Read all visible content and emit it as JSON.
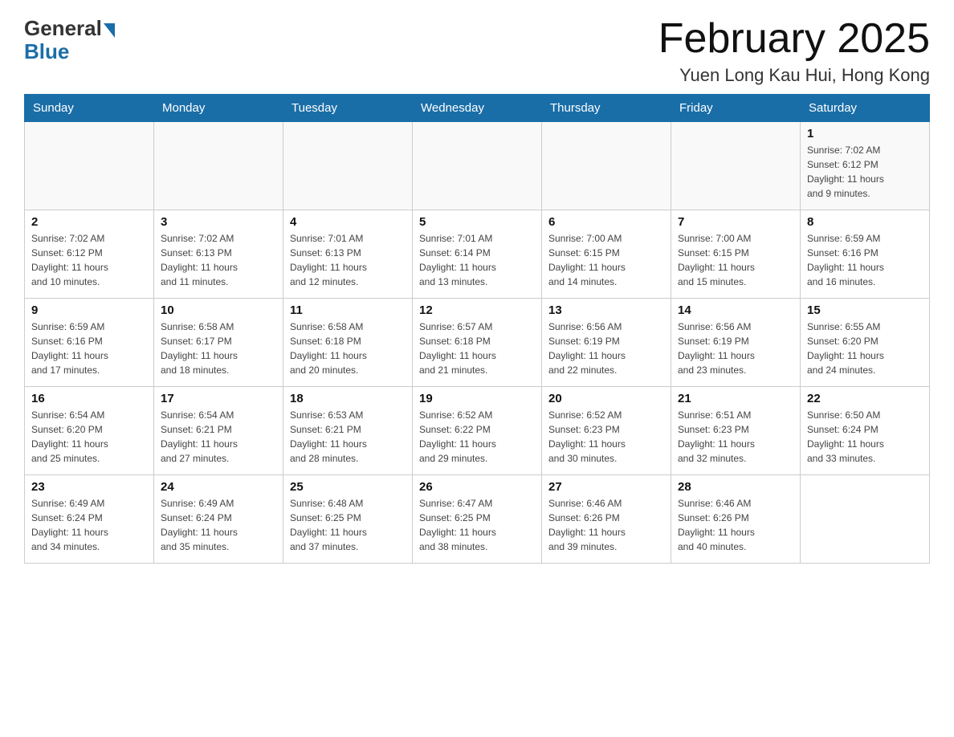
{
  "logo": {
    "general": "General",
    "blue": "Blue"
  },
  "title": "February 2025",
  "location": "Yuen Long Kau Hui, Hong Kong",
  "days_of_week": [
    "Sunday",
    "Monday",
    "Tuesday",
    "Wednesday",
    "Thursday",
    "Friday",
    "Saturday"
  ],
  "weeks": [
    [
      {
        "day": "",
        "info": ""
      },
      {
        "day": "",
        "info": ""
      },
      {
        "day": "",
        "info": ""
      },
      {
        "day": "",
        "info": ""
      },
      {
        "day": "",
        "info": ""
      },
      {
        "day": "",
        "info": ""
      },
      {
        "day": "1",
        "info": "Sunrise: 7:02 AM\nSunset: 6:12 PM\nDaylight: 11 hours\nand 9 minutes."
      }
    ],
    [
      {
        "day": "2",
        "info": "Sunrise: 7:02 AM\nSunset: 6:12 PM\nDaylight: 11 hours\nand 10 minutes."
      },
      {
        "day": "3",
        "info": "Sunrise: 7:02 AM\nSunset: 6:13 PM\nDaylight: 11 hours\nand 11 minutes."
      },
      {
        "day": "4",
        "info": "Sunrise: 7:01 AM\nSunset: 6:13 PM\nDaylight: 11 hours\nand 12 minutes."
      },
      {
        "day": "5",
        "info": "Sunrise: 7:01 AM\nSunset: 6:14 PM\nDaylight: 11 hours\nand 13 minutes."
      },
      {
        "day": "6",
        "info": "Sunrise: 7:00 AM\nSunset: 6:15 PM\nDaylight: 11 hours\nand 14 minutes."
      },
      {
        "day": "7",
        "info": "Sunrise: 7:00 AM\nSunset: 6:15 PM\nDaylight: 11 hours\nand 15 minutes."
      },
      {
        "day": "8",
        "info": "Sunrise: 6:59 AM\nSunset: 6:16 PM\nDaylight: 11 hours\nand 16 minutes."
      }
    ],
    [
      {
        "day": "9",
        "info": "Sunrise: 6:59 AM\nSunset: 6:16 PM\nDaylight: 11 hours\nand 17 minutes."
      },
      {
        "day": "10",
        "info": "Sunrise: 6:58 AM\nSunset: 6:17 PM\nDaylight: 11 hours\nand 18 minutes."
      },
      {
        "day": "11",
        "info": "Sunrise: 6:58 AM\nSunset: 6:18 PM\nDaylight: 11 hours\nand 20 minutes."
      },
      {
        "day": "12",
        "info": "Sunrise: 6:57 AM\nSunset: 6:18 PM\nDaylight: 11 hours\nand 21 minutes."
      },
      {
        "day": "13",
        "info": "Sunrise: 6:56 AM\nSunset: 6:19 PM\nDaylight: 11 hours\nand 22 minutes."
      },
      {
        "day": "14",
        "info": "Sunrise: 6:56 AM\nSunset: 6:19 PM\nDaylight: 11 hours\nand 23 minutes."
      },
      {
        "day": "15",
        "info": "Sunrise: 6:55 AM\nSunset: 6:20 PM\nDaylight: 11 hours\nand 24 minutes."
      }
    ],
    [
      {
        "day": "16",
        "info": "Sunrise: 6:54 AM\nSunset: 6:20 PM\nDaylight: 11 hours\nand 25 minutes."
      },
      {
        "day": "17",
        "info": "Sunrise: 6:54 AM\nSunset: 6:21 PM\nDaylight: 11 hours\nand 27 minutes."
      },
      {
        "day": "18",
        "info": "Sunrise: 6:53 AM\nSunset: 6:21 PM\nDaylight: 11 hours\nand 28 minutes."
      },
      {
        "day": "19",
        "info": "Sunrise: 6:52 AM\nSunset: 6:22 PM\nDaylight: 11 hours\nand 29 minutes."
      },
      {
        "day": "20",
        "info": "Sunrise: 6:52 AM\nSunset: 6:23 PM\nDaylight: 11 hours\nand 30 minutes."
      },
      {
        "day": "21",
        "info": "Sunrise: 6:51 AM\nSunset: 6:23 PM\nDaylight: 11 hours\nand 32 minutes."
      },
      {
        "day": "22",
        "info": "Sunrise: 6:50 AM\nSunset: 6:24 PM\nDaylight: 11 hours\nand 33 minutes."
      }
    ],
    [
      {
        "day": "23",
        "info": "Sunrise: 6:49 AM\nSunset: 6:24 PM\nDaylight: 11 hours\nand 34 minutes."
      },
      {
        "day": "24",
        "info": "Sunrise: 6:49 AM\nSunset: 6:24 PM\nDaylight: 11 hours\nand 35 minutes."
      },
      {
        "day": "25",
        "info": "Sunrise: 6:48 AM\nSunset: 6:25 PM\nDaylight: 11 hours\nand 37 minutes."
      },
      {
        "day": "26",
        "info": "Sunrise: 6:47 AM\nSunset: 6:25 PM\nDaylight: 11 hours\nand 38 minutes."
      },
      {
        "day": "27",
        "info": "Sunrise: 6:46 AM\nSunset: 6:26 PM\nDaylight: 11 hours\nand 39 minutes."
      },
      {
        "day": "28",
        "info": "Sunrise: 6:46 AM\nSunset: 6:26 PM\nDaylight: 11 hours\nand 40 minutes."
      },
      {
        "day": "",
        "info": ""
      }
    ]
  ]
}
